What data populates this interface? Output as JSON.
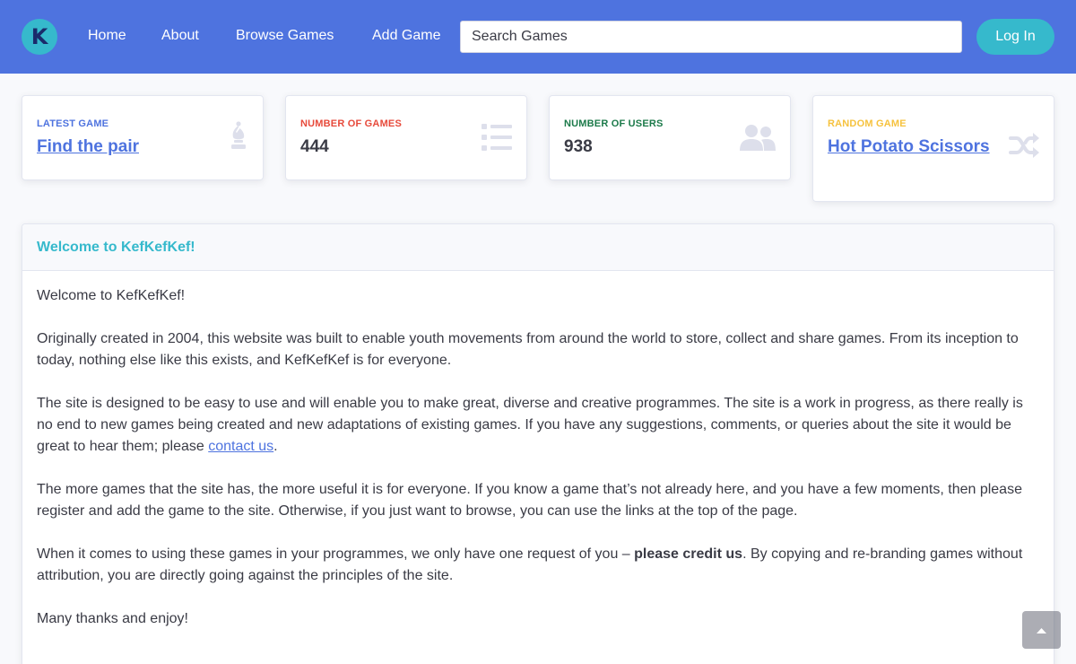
{
  "brand": {
    "logo_letter": "K"
  },
  "nav": {
    "items": [
      {
        "label": "Home"
      },
      {
        "label": "About"
      },
      {
        "label": "Browse Games"
      },
      {
        "label": "Add Game"
      }
    ]
  },
  "search": {
    "placeholder": "Search Games"
  },
  "header": {
    "login_label": "Log In"
  },
  "colors": {
    "primary": "#4e73df",
    "info": "#36b9cc",
    "danger": "#e74a3b",
    "success": "#1cc88a",
    "warning": "#f6c23e"
  },
  "cards": [
    {
      "label": "Latest Game",
      "value": "Find the pair",
      "icon": "chess-bishop-icon",
      "label_color": "#4e73df"
    },
    {
      "label": "Number of Games",
      "value": "444",
      "icon": "list-icon",
      "label_color": "#e74a3b"
    },
    {
      "label": "Number of Users",
      "value": "938",
      "icon": "users-icon",
      "label_color": "#1c7a4a"
    },
    {
      "label": "Random Game",
      "value": "Hot Potato Scissors",
      "icon": "shuffle-icon",
      "label_color": "#f6c23e"
    }
  ],
  "welcome": {
    "title": "Welcome to KefKefKef!",
    "p1": "Welcome to KefKefKef!",
    "p2": "Originally created in 2004, this website was built to enable youth movements from around the world to store, collect and share games. From its inception to today, nothing else like this exists, and KefKefKef is for everyone.",
    "p3_before": "The site is designed to be easy to use and will enable you to make great, diverse and creative programmes. The site is a work in progress, as there really is no end to new games being created and new adaptations of existing games. If you have any suggestions, comments, or queries about the site it would be great to hear them; please ",
    "p3_link": "contact us",
    "p3_after": ".",
    "p4": "The more games that the site has, the more useful it is for everyone. If you know a game that’s not already here, and you have a few moments, then please register and add the game to the site. Otherwise, if you just want to browse, you can use the links at the top of the page.",
    "p5_before": "When it comes to using these games in your programmes, we only have one request of you – ",
    "p5_bold": "please credit us",
    "p5_after": ". By copying and re-branding games without attribution, you are directly going against the principles of the site.",
    "p6": "Many thanks and enjoy!"
  },
  "scroll_top": {
    "icon": "chevron-up-icon"
  }
}
